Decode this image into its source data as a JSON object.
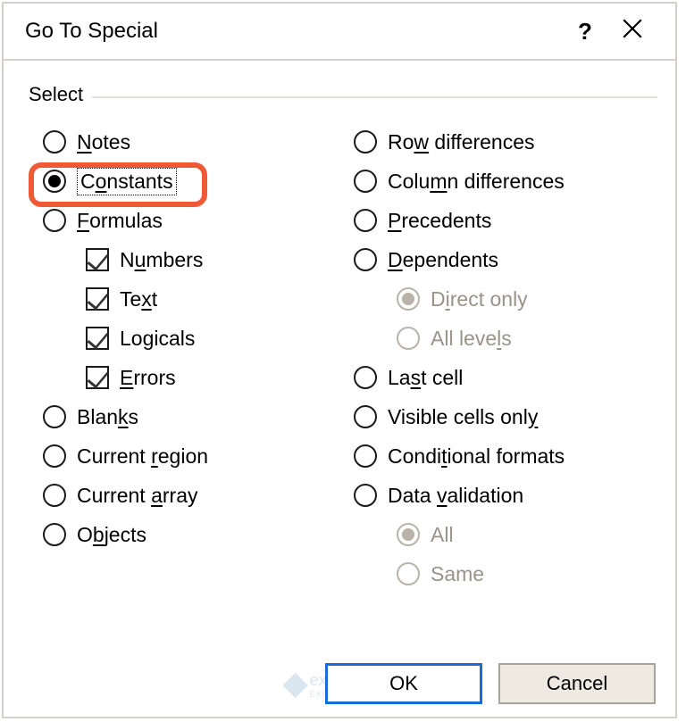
{
  "title": "Go To Special",
  "group": "Select",
  "left": {
    "notes": "Notes",
    "constants": "Constants",
    "formulas": "Formulas",
    "numbers": "Numbers",
    "text": "Text",
    "logicals": "Logicals",
    "errors": "Errors",
    "blanks": "Blanks",
    "current_region": "Current region",
    "current_array": "Current array",
    "objects": "Objects"
  },
  "right": {
    "row_diff": "Row differences",
    "col_diff": "Column differences",
    "precedents": "Precedents",
    "dependents": "Dependents",
    "direct_only": "Direct only",
    "all_levels": "All levels",
    "last_cell": "Last cell",
    "visible": "Visible cells only",
    "conditional": "Conditional formats",
    "data_validation": "Data validation",
    "all": "All",
    "same": "Same"
  },
  "selected": "constants",
  "checkboxes": {
    "numbers": true,
    "text": true,
    "logicals": true,
    "errors": true
  },
  "buttons": {
    "ok": "OK",
    "cancel": "Cancel"
  },
  "underline": {
    "notes": "N",
    "constants": "o",
    "formulas": "F",
    "numbers": "u",
    "text": "x",
    "logicals": "g",
    "errors": "E",
    "blanks": "k",
    "current_region": "r",
    "current_array": "a",
    "objects": "b",
    "row_diff": "w",
    "col_diff": "m",
    "precedents": "P",
    "dependents": "D",
    "direct_only": "I",
    "all_levels": "l",
    "last_cell": "s",
    "visible": "y",
    "conditional": "t",
    "data_validation": "v"
  },
  "watermark": {
    "name": "exceldemy",
    "sub": "EXCEL · DATA · BI"
  }
}
